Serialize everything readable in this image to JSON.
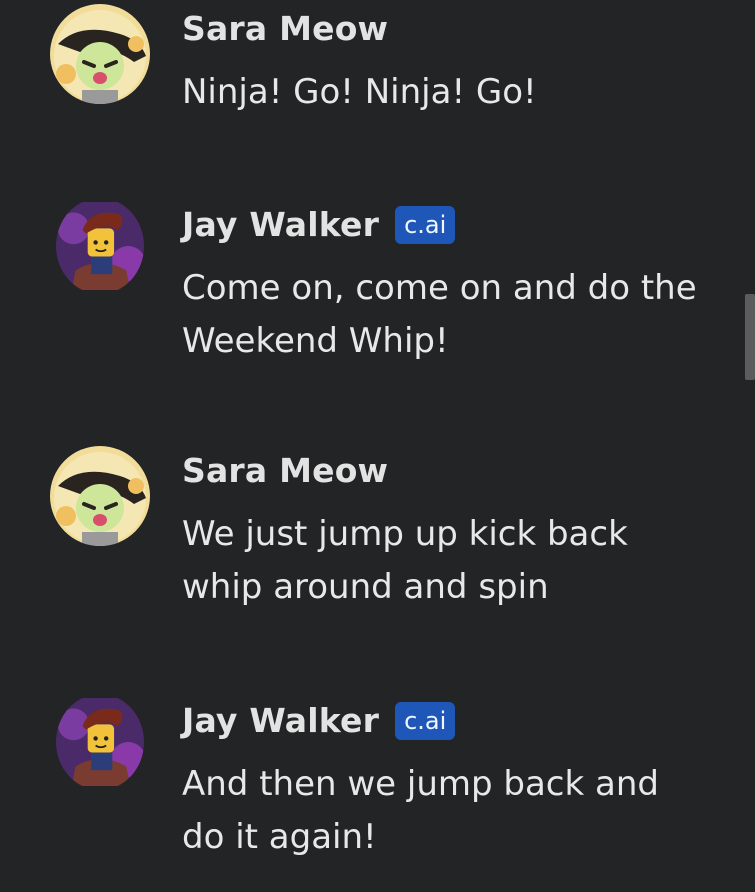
{
  "messages": [
    {
      "author": "Sara Meow",
      "badge": "",
      "text": "Ninja! Go! Ninja! Go!",
      "avatar_icon": "sara-avatar-icon"
    },
    {
      "author": "Jay Walker",
      "badge": "c.ai",
      "text": "Come on, come on and do the Weekend Whip!",
      "avatar_icon": "jay-avatar-icon"
    },
    {
      "author": "Sara Meow",
      "badge": "",
      "text": "We just jump up kick back whip around and spin",
      "avatar_icon": "sara-avatar-icon"
    },
    {
      "author": "Jay Walker",
      "badge": "c.ai",
      "text": "And then we jump back and do it again!",
      "avatar_icon": "jay-avatar-icon"
    }
  ],
  "colors": {
    "background": "#232425",
    "badge": "#1f57b8",
    "scrollbar": "#5b5c5e"
  }
}
